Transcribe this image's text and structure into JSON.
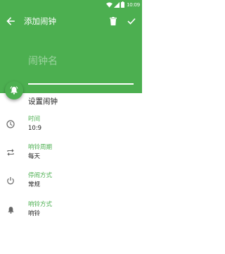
{
  "colors": {
    "primary": "#4caf50",
    "text": "#222222",
    "icon": "#666666"
  },
  "status_bar": {
    "time": "10:09"
  },
  "app_bar": {
    "title": "添加闹钟"
  },
  "alarm_name": {
    "placeholder": "闹钟名",
    "value": ""
  },
  "section": {
    "title": "设置闹钟"
  },
  "settings": [
    {
      "icon": "clock-icon",
      "label": "时间",
      "value": "10:9"
    },
    {
      "icon": "repeat-icon",
      "label": "响铃周期",
      "value": "每天"
    },
    {
      "icon": "power-icon",
      "label": "停闹方式",
      "value": "常规"
    },
    {
      "icon": "bell-icon",
      "label": "响铃方式",
      "value": "响铃"
    }
  ]
}
